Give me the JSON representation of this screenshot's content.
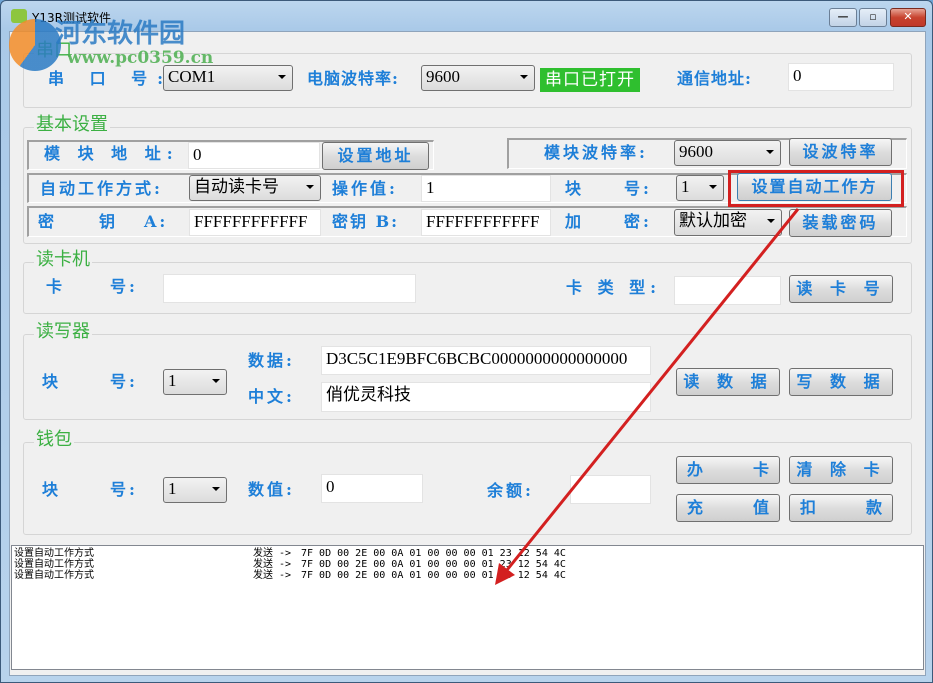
{
  "window": {
    "title": "Y13R测试软件",
    "controls": {
      "minimize": "—",
      "maximize": "▫",
      "close": "✕"
    }
  },
  "watermark": {
    "site_name": "河东软件园",
    "url": "www.pc0359.cn"
  },
  "serial_group": {
    "title": "串口",
    "port_label": "串 口 号:",
    "port_value": "COM1",
    "pc_baud_label": "电脑波特率:",
    "pc_baud_value": "9600",
    "status": "串口已打开",
    "comm_addr_label": "通信地址:",
    "comm_addr_value": "0"
  },
  "basic_group": {
    "title": "基本设置",
    "module_addr_label": "模 块 地 址:",
    "module_addr_value": "0",
    "set_addr_button": "设置地址",
    "module_baud_label": "模块波特率:",
    "module_baud_value": "9600",
    "set_baud_button": "设波特率",
    "auto_mode_label": "自动工作方式:",
    "auto_mode_value": "自动读卡号",
    "op_value_label": "操作值:",
    "op_value": "1",
    "block_label_1": "块",
    "block_label_2": "号:",
    "block_value": "1",
    "set_auto_button": "设置自动工作方",
    "key_a_label_1": "密",
    "key_a_label_2": "钥",
    "key_a_label_3": "A:",
    "key_a_value": "FFFFFFFFFFFF",
    "key_b_label": "密钥 B:",
    "key_b_value": "FFFFFFFFFFFF",
    "encrypt_label_1": "加",
    "encrypt_label_2": "密:",
    "encrypt_value": "默认加密",
    "load_key_button": "装载密码"
  },
  "reader_group": {
    "title": "读卡机",
    "card_no_label_1": "卡",
    "card_no_label_2": "号:",
    "card_no_value": "",
    "card_type_label": "卡 类 型:",
    "card_type_value": "",
    "read_card_button": "读 卡 号"
  },
  "rw_group": {
    "title": "读写器",
    "block_label_1": "块",
    "block_label_2": "号:",
    "block_value": "1",
    "data_label": "数据:",
    "data_value": "D3C5C1E9BFC6BCBC0000000000000000",
    "chinese_label": "中文:",
    "chinese_value": "俏优灵科技",
    "read_data_button": "读 数 据",
    "write_data_button": "写 数 据"
  },
  "wallet_group": {
    "title": "钱包",
    "block_label_1": "块",
    "block_label_2": "号:",
    "block_value": "1",
    "amount_label": "数值:",
    "amount_value": "0",
    "balance_label": "余额:",
    "balance_value": "",
    "issue_card_button": [
      "办",
      "卡"
    ],
    "clear_card_button": "清 除 卡",
    "recharge_button": [
      "充",
      "值"
    ],
    "deduct_button": [
      "扣",
      "款"
    ]
  },
  "log": {
    "rows": [
      {
        "action": "设置自动工作方式",
        "direction": "发送 ->",
        "bytes": "7F 0D 00 2E 00 0A 01 00 00 00 01 23 12 54 4C"
      },
      {
        "action": "设置自动工作方式",
        "direction": "发送 ->",
        "bytes": "7F 0D 00 2E 00 0A 01 00 00 00 01 23 12 54 4C"
      },
      {
        "action": "设置自动工作方式",
        "direction": "发送 ->",
        "bytes": "7F 0D 00 2E 00 0A 01 00 00 00 01 23 12 54 4C"
      }
    ]
  },
  "annotation": {
    "color": "#d32020"
  },
  "colors": {
    "label": "#1e7fd8",
    "group_title": "#3cb043",
    "status_bg": "#2fbf2f"
  }
}
